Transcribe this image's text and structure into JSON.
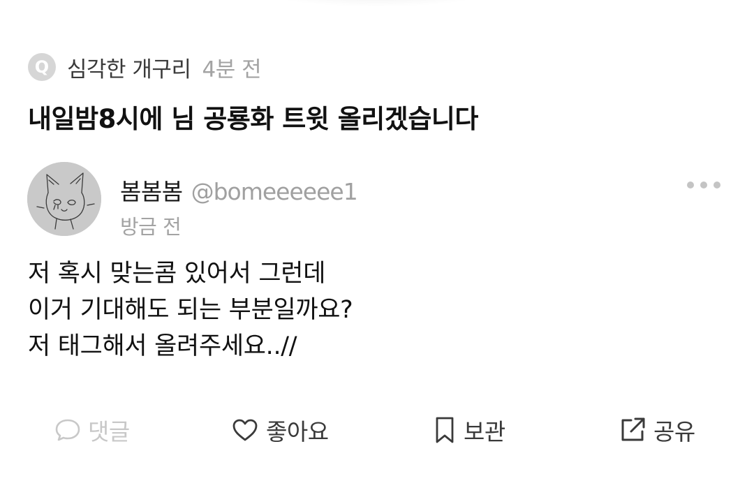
{
  "question": {
    "badge": "Q",
    "author": "심각한 개구리",
    "time": "4분 전",
    "title": "내일밤8시에 님 공룡화 트윗 올리겠습니다"
  },
  "answer": {
    "avatar_icon": "cat-sketch-avatar",
    "name": "봄봄봄",
    "handle": "@bomeeeeee1",
    "time": "방금 전",
    "more_icon": "more-dots-icon",
    "body_lines": [
      "저 혹시 맞는콤 있어서 그런데",
      "이거 기대해도 되는 부분일까요?",
      "저 태그해서 올려주세요..//"
    ]
  },
  "actions": {
    "comment": {
      "label": "댓글",
      "icon": "comment-icon",
      "enabled": false
    },
    "like": {
      "label": "좋아요",
      "icon": "heart-icon"
    },
    "save": {
      "label": "보관",
      "icon": "bookmark-icon"
    },
    "share": {
      "label": "공유",
      "icon": "share-icon"
    }
  },
  "colors": {
    "badge_bg": "#d6d6d6",
    "muted_text": "#a3a3a3",
    "disabled_text": "#c8c8c8",
    "icon_dark": "#3a3a3a"
  }
}
